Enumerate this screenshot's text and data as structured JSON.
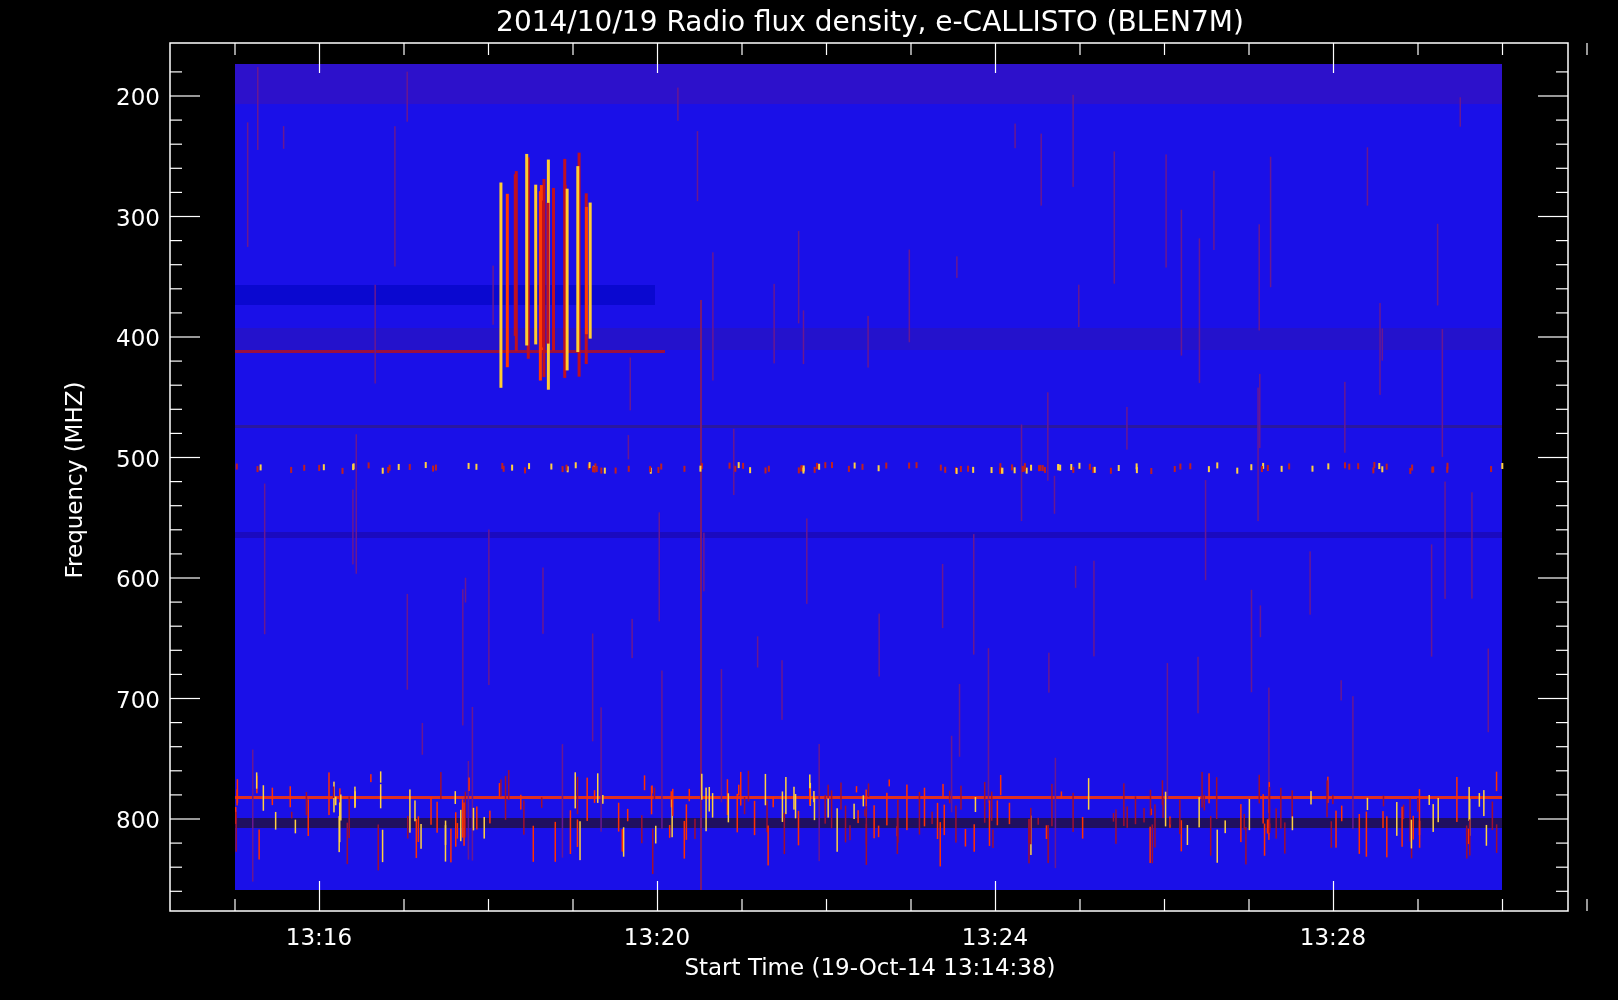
{
  "title": "2014/10/19  Radio flux density, e-CALLISTO (BLEN7M)",
  "y_axis": {
    "label": "Frequency (MHZ)",
    "ticks": [
      "200",
      "300",
      "400",
      "500",
      "600",
      "700",
      "800"
    ]
  },
  "x_axis": {
    "label": "Start Time (19-Oct-14 13:14:38)",
    "ticks": [
      "13:16",
      "13:20",
      "13:24",
      "13:28"
    ]
  }
}
